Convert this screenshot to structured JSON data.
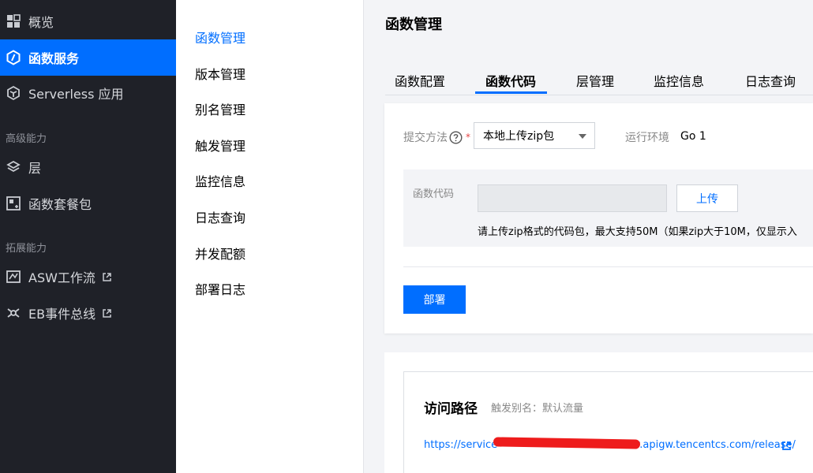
{
  "sidebar": {
    "items": [
      {
        "label": "概览",
        "icon": "grid-icon"
      },
      {
        "label": "函数服务",
        "icon": "function-icon",
        "active": true
      },
      {
        "label": "Serverless 应用",
        "icon": "serverless-app-icon"
      }
    ],
    "group_advanced": "高级能力",
    "advanced_items": [
      {
        "label": "层",
        "icon": "layers-icon"
      },
      {
        "label": "函数套餐包",
        "icon": "package-icon"
      }
    ],
    "group_extension": "拓展能力",
    "extension_items": [
      {
        "label": "ASW工作流",
        "icon": "workflow-icon"
      },
      {
        "label": "EB事件总线",
        "icon": "event-bus-icon"
      }
    ]
  },
  "submenu": {
    "items": [
      "函数管理",
      "版本管理",
      "别名管理",
      "触发管理",
      "监控信息",
      "日志查询",
      "并发配额",
      "部署日志"
    ],
    "active_index": 0
  },
  "main": {
    "title": "函数管理",
    "tabs": [
      "函数配置",
      "函数代码",
      "层管理",
      "监控信息",
      "日志查询"
    ],
    "active_tab": 1
  },
  "code_card": {
    "submit_method_label": "提交方法",
    "submit_method_value": "本地上传zip包",
    "runtime_label": "运行环境",
    "runtime_value": "Go 1",
    "code_label": "函数代码",
    "upload_label": "上传",
    "hint": "请上传zip格式的代码包，最大支持50M（如果zip大于10M，仅显示入",
    "deploy_label": "部署"
  },
  "access_card": {
    "title": "访问路径",
    "alias": "触发别名：默认流量",
    "url_prefix": "https://service-",
    "url_suffix": "w.apigw.tencentcs.com/release/"
  },
  "colors": {
    "sidebar_bg": "#1f2128",
    "accent": "#006eff",
    "redaction": "#ee1c1c"
  }
}
